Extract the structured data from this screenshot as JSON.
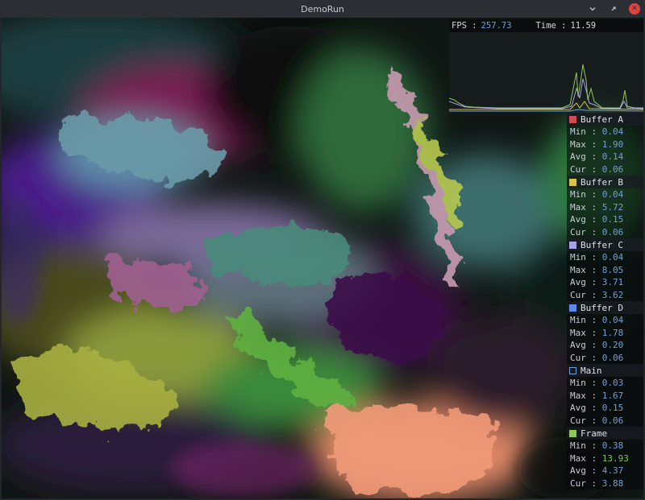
{
  "window": {
    "title": "DemoRun",
    "minimize_icon": "chevron-down-icon",
    "maximize_icon": "restore-icon",
    "close_icon": "close-icon"
  },
  "overlay": {
    "fps_label": "FPS :",
    "fps_value": "257.73",
    "time_label": "Time :",
    "time_value": "11.59"
  },
  "stats": [
    {
      "name": "Buffer A",
      "color": "#d24a55",
      "filled": true,
      "rows": [
        {
          "label": "Min : ",
          "value": "0.04"
        },
        {
          "label": "Max : ",
          "value": "1.90"
        },
        {
          "label": "Avg : ",
          "value": "0.14"
        },
        {
          "label": "Cur : ",
          "value": "0.06"
        }
      ]
    },
    {
      "name": "Buffer B",
      "color": "#d9c24e",
      "filled": true,
      "rows": [
        {
          "label": "Min : ",
          "value": "0.04"
        },
        {
          "label": "Max : ",
          "value": "5.72"
        },
        {
          "label": "Avg : ",
          "value": "0.15"
        },
        {
          "label": "Cur : ",
          "value": "0.06"
        }
      ]
    },
    {
      "name": "Buffer C",
      "color": "#a8a2e6",
      "filled": true,
      "rows": [
        {
          "label": "Min : ",
          "value": "0.04"
        },
        {
          "label": "Max : ",
          "value": "8.05"
        },
        {
          "label": "Avg : ",
          "value": "3.71"
        },
        {
          "label": "Cur : ",
          "value": "3.62"
        }
      ]
    },
    {
      "name": "Buffer D",
      "color": "#5a8ce8",
      "filled": true,
      "rows": [
        {
          "label": "Min : ",
          "value": "0.04"
        },
        {
          "label": "Max : ",
          "value": "1.78"
        },
        {
          "label": "Avg : ",
          "value": "0.20"
        },
        {
          "label": "Cur : ",
          "value": "0.06"
        }
      ]
    },
    {
      "name": "Main",
      "color": "#6fa0d8",
      "filled": false,
      "rows": [
        {
          "label": "Min : ",
          "value": "0.03"
        },
        {
          "label": "Max : ",
          "value": "1.67"
        },
        {
          "label": "Avg : ",
          "value": "0.15"
        },
        {
          "label": "Cur : ",
          "value": "0.06"
        }
      ]
    },
    {
      "name": "Frame",
      "color": "#8fc85a",
      "filled": true,
      "rows": [
        {
          "label": "Min : ",
          "value": "0.38"
        },
        {
          "label": "Max : ",
          "value": "13.93",
          "highlight": true
        },
        {
          "label": "Avg : ",
          "value": "4.37"
        },
        {
          "label": "Cur : ",
          "value": "3.88"
        }
      ]
    }
  ]
}
